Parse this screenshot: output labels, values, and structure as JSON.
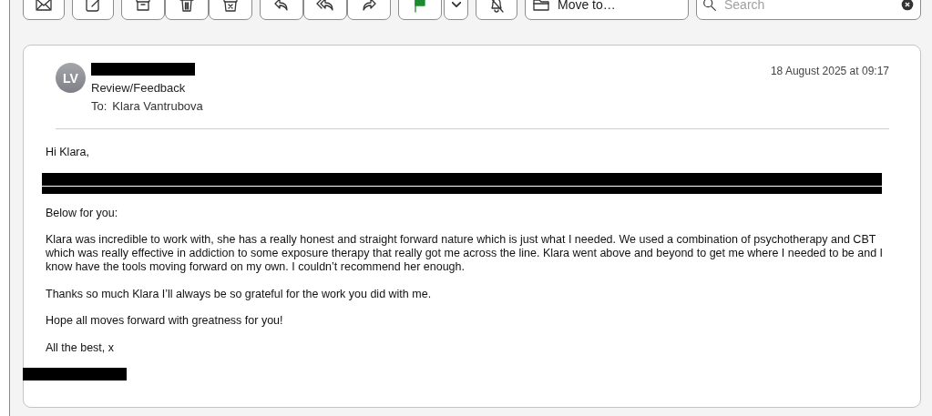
{
  "toolbar": {
    "groups": [
      [
        {
          "kind": "envelope"
        }
      ],
      [
        {
          "kind": "compose"
        }
      ],
      [
        {
          "kind": "archive"
        },
        {
          "kind": "trash"
        },
        {
          "kind": "junk"
        }
      ],
      [
        {
          "kind": "reply"
        },
        {
          "kind": "reply-all"
        },
        {
          "kind": "forward"
        }
      ],
      [
        {
          "kind": "flag"
        },
        {
          "kind": "chevron"
        }
      ],
      [
        {
          "kind": "bell-off"
        }
      ]
    ],
    "move_to": {
      "label": "Move to…"
    },
    "search": {
      "placeholder": "Search"
    }
  },
  "message": {
    "avatar": "LV",
    "sender": {
      "kind": "redaction"
    },
    "subject": "Review/Feedback",
    "to_label": "To:",
    "recipient": "Klara Vantrubova",
    "date": "18 August 2025 at 09:17",
    "body": [
      {
        "kind": "paragraph",
        "text": "Hi Klara,"
      },
      {
        "kind": "redaction"
      },
      {
        "kind": "paragraph",
        "text": "Below for you:"
      },
      {
        "kind": "paragraph",
        "text": "Klara was incredible to work with, she has a really honest and straight forward nature which is just what I needed. We used a combination of psychotherapy and CBT which was really effective in addiction to some exposure therapy that really got me across the line. Klara went above and beyond to get me where I needed to be and I know have the tools moving forward on my own. I couldn’t recommend her enough."
      },
      {
        "kind": "paragraph",
        "text": "Thanks so much Klara I’ll always be so grateful for the work you did with me."
      },
      {
        "kind": "paragraph",
        "text": "Hope all moves forward with greatness for you!"
      },
      {
        "kind": "paragraph",
        "text": "All the best, x"
      },
      {
        "kind": "signature-redaction"
      }
    ]
  }
}
